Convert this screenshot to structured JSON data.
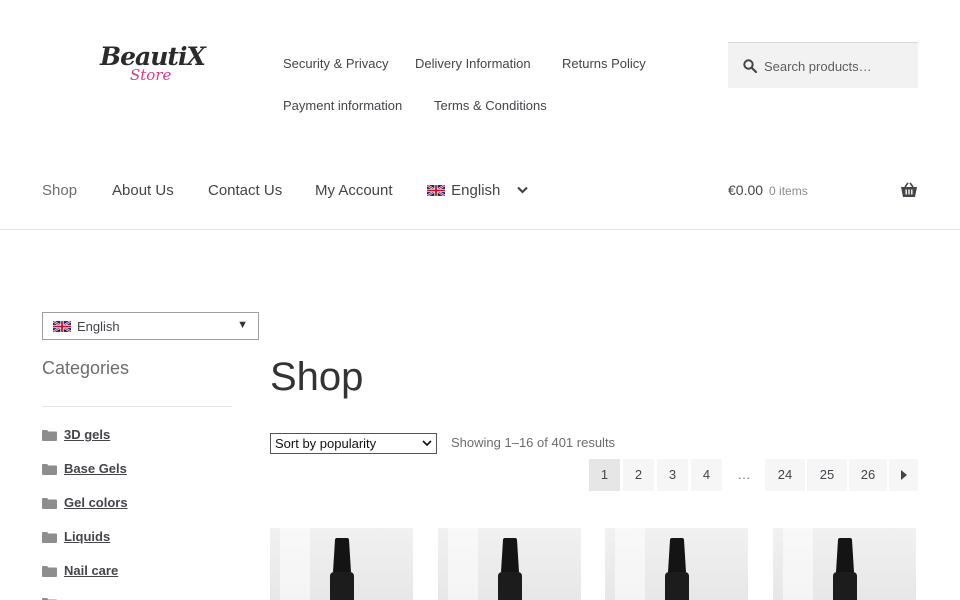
{
  "logo": {
    "main": "BeautiX",
    "sub": "Store"
  },
  "top_links": [
    "Security & Privacy",
    "Delivery Information",
    "Returns Policy",
    "Payment information",
    "Terms & Conditions"
  ],
  "search": {
    "placeholder": "Search products…",
    "value": ""
  },
  "nav": {
    "items": [
      "Shop",
      "About Us",
      "Contact Us",
      "My Account"
    ],
    "active": "Shop",
    "language": "English"
  },
  "cart": {
    "total": "€0.00",
    "count": "0 items"
  },
  "sidebar": {
    "language": "English",
    "categories_title": "Categories",
    "categories": [
      "3D gels",
      "Base Gels",
      "Gel colors",
      "Liquids",
      "Nail care"
    ]
  },
  "shop": {
    "title": "Shop",
    "sort": "Sort by popularity",
    "results": "Showing 1–16 of 401 results",
    "pagination": [
      "1",
      "2",
      "3",
      "4",
      "…",
      "24",
      "25",
      "26"
    ],
    "current_page": "1"
  },
  "colors": {
    "accent": "#d63c86",
    "text": "#43454b",
    "muted": "#6d6d6d"
  },
  "icons": [
    "search-icon",
    "basket-icon",
    "chevron-down-icon",
    "folder-icon",
    "uk-flag-icon",
    "arrow-right-icon"
  ]
}
